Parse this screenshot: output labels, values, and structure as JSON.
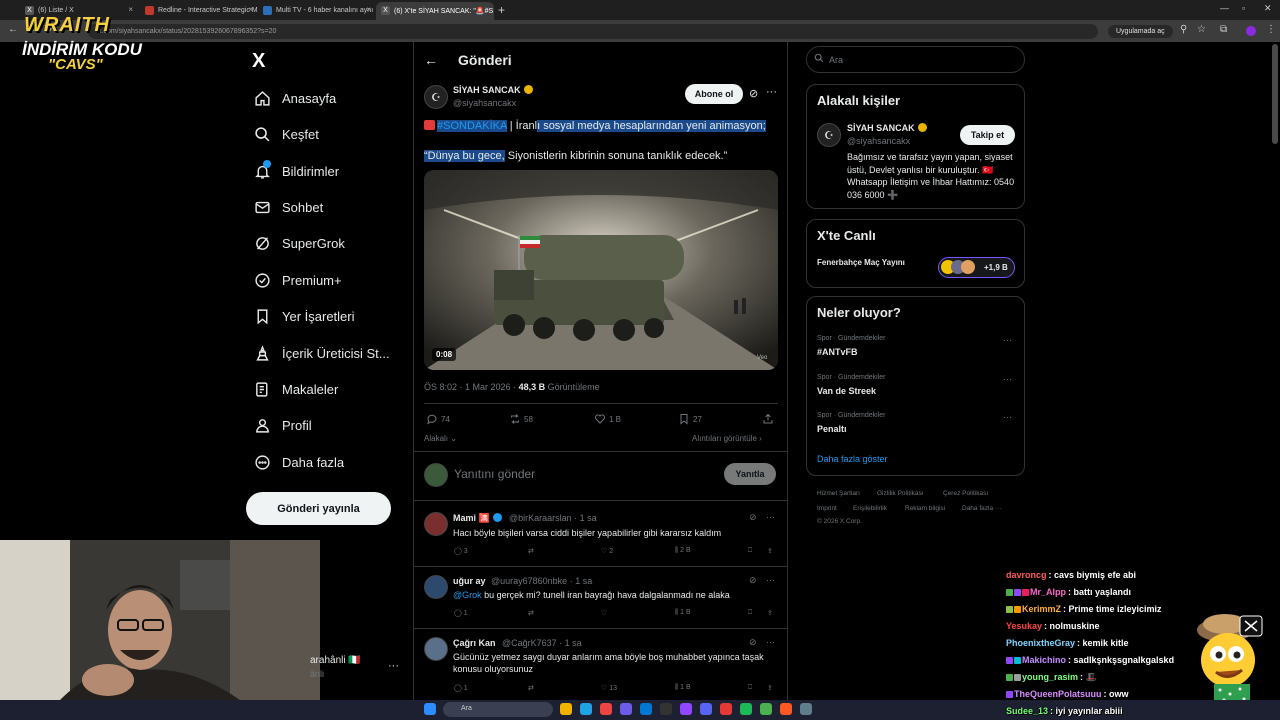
{
  "browser": {
    "tabs": [
      {
        "label": "(6) Liste / X",
        "active": false
      },
      {
        "label": "Redline - Interactive Strategic M",
        "active": false
      },
      {
        "label": "Multi TV - 6 haber kanalını aynı",
        "active": false
      },
      {
        "label": "(6) X'te SİYAH SANCAK: \"🚨#S",
        "active": true
      }
    ],
    "url": "x.com/siyahsancakx/status/2028153926067896352?s=20",
    "translate_chip": "Uygulamada aç"
  },
  "promo": {
    "line1": "WRAITH",
    "line2": "İNDİRİM KODU",
    "line3": "\"CAVS\""
  },
  "sidebar": {
    "logo": "X",
    "items": [
      {
        "label": "Anasayfa",
        "icon": "home-icon"
      },
      {
        "label": "Keşfet",
        "icon": "search-icon"
      },
      {
        "label": "Bildirimler",
        "icon": "bell-icon"
      },
      {
        "label": "Sohbet",
        "icon": "mail-icon"
      },
      {
        "label": "SuperGrok",
        "icon": "grok-icon"
      },
      {
        "label": "Premium+",
        "icon": "premium-icon"
      },
      {
        "label": "Yer İşaretleri",
        "icon": "bookmark-icon"
      },
      {
        "label": "İçerik Üreticisi St...",
        "icon": "creator-icon"
      },
      {
        "label": "Makaleler",
        "icon": "article-icon"
      },
      {
        "label": "Profil",
        "icon": "person-icon"
      },
      {
        "label": "Daha fazla",
        "icon": "more-circle-icon"
      }
    ],
    "post_button": "Gönderi yayınla",
    "account_name": "arahânli 🇮🇹",
    "account_handle": "ânli",
    "account_more": "···"
  },
  "main": {
    "title": "Gönderi",
    "tweet": {
      "author_name": "SİYAH SANCAK",
      "author_handle": "@siyahsancakx",
      "subscribe_label": "Abone ol",
      "hashtag": "#SONDAKİKA",
      "text_line1_plain": " | İranl",
      "text_line1_highlight": "ı sosyal medya hesaplarından yeni animasyon;",
      "text_line2_highlight": "“Dünya bu gece,",
      "text_line2_plain": " Siyonistlerin kibrinin sonuna tanıklık edecek.”",
      "video_time": "0:08",
      "video_watermark": "Veo",
      "time": "ÖS 8:02",
      "date": "1 Mar 2026",
      "views": "48,3 B",
      "views_label": "Görüntüleme",
      "replies": "74",
      "retweets": "58",
      "likes": "1 B",
      "bookmarks": "27",
      "related": "Alakalı",
      "quotes": "Alıntıları görüntüle"
    },
    "reply_box": {
      "placeholder": "Yanıtını gönder",
      "button": "Yanıtla"
    },
    "replies": [
      {
        "name": "Mami",
        "handle": "@birKaraarslan · 1 sa",
        "text": "Hacı böyle bişileri varsa ciddi bişiler yapabilirler gibi kararsız kaldım",
        "mention": "",
        "replies": "3",
        "retweets": "",
        "likes": "2",
        "views": "2 B"
      },
      {
        "name": "uğur ay",
        "handle": "@uuray67860nbke · 1 sa",
        "text": "bu gerçek mi? tunell iran bayrağı hava dalgalanmadı ne alaka",
        "mention": "@Grok",
        "replies": "1",
        "retweets": "",
        "likes": "",
        "views": "1 B"
      },
      {
        "name": "Çağrı Kan",
        "handle": "@CağrK7637 · 1 sa",
        "text": "Gücünüz yetmez saygı duyar anlarım ama  böyle boş muhabbet  yapınca taşak konusu oluyorsunuz",
        "mention": "",
        "replies": "1",
        "retweets": "",
        "likes": "13",
        "views": "1 B"
      }
    ]
  },
  "right": {
    "search_placeholder": "Ara",
    "related_title": "Alakalı kişiler",
    "related_person": {
      "name": "SİYAH SANCAK",
      "handle": "@siyahsancakx",
      "follow_label": "Takip et",
      "bio": "Bağımsız ve tarafsız yayın yapan, siyaset üstü, Devlet yanlısı bir kuruluştur. 🇹🇷 Whatsapp İletişim ve İhbar Hattımız: 0540 036 6000 ➕"
    },
    "live_title": "X'te Canlı",
    "live_item": "Fenerbahçe Maç Yayını",
    "live_count": "+1,9 B",
    "trends_title": "Neler oluyor?",
    "trends": [
      {
        "category": "Spor · Gündemdekiler",
        "name": "#ANTvFB"
      },
      {
        "category": "Spor · Gündemdekiler",
        "name": "Van de Streek"
      },
      {
        "category": "Spor · Gündemdekiler",
        "name": "Penaltı"
      }
    ],
    "show_more": "Daha fazla göster",
    "footer_row1": [
      "Hizmet Şartları",
      "Gizlilik Politikası",
      "Çerez Politikası"
    ],
    "footer_row2": [
      "Imprint",
      "Erişilebilirlik",
      "Reklam bilgisi",
      "Daha fazla ···"
    ],
    "copyright": "© 2026 X Corp."
  },
  "chat": [
    {
      "user": "davroncg",
      "msg": ": cavs biymiş efe abi",
      "color": "#ff5a5a"
    },
    {
      "user": "Mr_Alpp",
      "msg": ": battı yaşlandı",
      "color": "#ff66cc"
    },
    {
      "user": "KerimmZ",
      "msg": ": Prime time izleyicimiz",
      "color": "#ffae3d"
    },
    {
      "user": "Yesukay",
      "msg": ": nolmuskine",
      "color": "#ff4444"
    },
    {
      "user": "PhoenixtheGray",
      "msg": ": kemik kitle",
      "color": "#7fd6ff"
    },
    {
      "user": "Makichino",
      "msg": ": sadlkşnkşsgnalkgalskd",
      "color": "#c58cff"
    },
    {
      "user": "young_rasim",
      "msg": ": 🎩",
      "color": "#7dff7d"
    },
    {
      "user": "TheQueenPolatsuuu",
      "msg": ": oww",
      "color": "#d78cff"
    },
    {
      "user": "Sudee_13",
      "msg": ": iyi yayınlar abiii",
      "color": "#6eff6e"
    }
  ],
  "taskbar": {
    "search": "Ara"
  },
  "colors": {
    "accent": "#1d9bf0",
    "background": "#000000",
    "border": "#2f3336",
    "muted_text": "#71767b",
    "highlight": "#1a4a8c"
  }
}
